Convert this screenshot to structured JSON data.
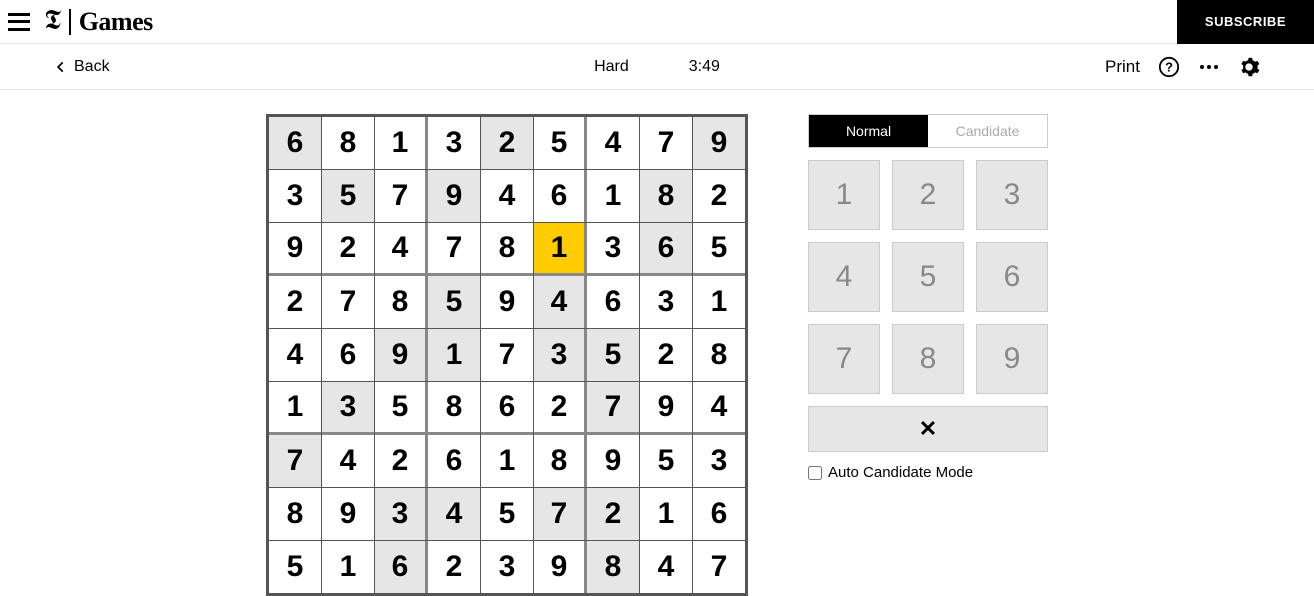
{
  "header": {
    "brand_t": "𝕿",
    "brand_name": "Games",
    "subscribe": "SUBSCRIBE"
  },
  "toolbar": {
    "back": "Back",
    "difficulty": "Hard",
    "timer": "3:49",
    "print": "Print"
  },
  "sudoku": {
    "selected": [
      2,
      5
    ],
    "grid": [
      [
        {
          "v": "6",
          "g": true
        },
        {
          "v": "8",
          "g": false
        },
        {
          "v": "1",
          "g": false
        },
        {
          "v": "3",
          "g": false
        },
        {
          "v": "2",
          "g": true
        },
        {
          "v": "5",
          "g": false
        },
        {
          "v": "4",
          "g": false
        },
        {
          "v": "7",
          "g": false
        },
        {
          "v": "9",
          "g": true
        }
      ],
      [
        {
          "v": "3",
          "g": false
        },
        {
          "v": "5",
          "g": true
        },
        {
          "v": "7",
          "g": false
        },
        {
          "v": "9",
          "g": true
        },
        {
          "v": "4",
          "g": false
        },
        {
          "v": "6",
          "g": false
        },
        {
          "v": "1",
          "g": false
        },
        {
          "v": "8",
          "g": true
        },
        {
          "v": "2",
          "g": false
        }
      ],
      [
        {
          "v": "9",
          "g": false
        },
        {
          "v": "2",
          "g": false
        },
        {
          "v": "4",
          "g": false
        },
        {
          "v": "7",
          "g": false
        },
        {
          "v": "8",
          "g": false
        },
        {
          "v": "1",
          "g": false
        },
        {
          "v": "3",
          "g": false
        },
        {
          "v": "6",
          "g": true
        },
        {
          "v": "5",
          "g": false
        }
      ],
      [
        {
          "v": "2",
          "g": false
        },
        {
          "v": "7",
          "g": false
        },
        {
          "v": "8",
          "g": false
        },
        {
          "v": "5",
          "g": true
        },
        {
          "v": "9",
          "g": false
        },
        {
          "v": "4",
          "g": true
        },
        {
          "v": "6",
          "g": false
        },
        {
          "v": "3",
          "g": false
        },
        {
          "v": "1",
          "g": false
        }
      ],
      [
        {
          "v": "4",
          "g": false
        },
        {
          "v": "6",
          "g": false
        },
        {
          "v": "9",
          "g": true
        },
        {
          "v": "1",
          "g": true
        },
        {
          "v": "7",
          "g": false
        },
        {
          "v": "3",
          "g": true
        },
        {
          "v": "5",
          "g": true
        },
        {
          "v": "2",
          "g": false
        },
        {
          "v": "8",
          "g": false
        }
      ],
      [
        {
          "v": "1",
          "g": false
        },
        {
          "v": "3",
          "g": true
        },
        {
          "v": "5",
          "g": false
        },
        {
          "v": "8",
          "g": false
        },
        {
          "v": "6",
          "g": false
        },
        {
          "v": "2",
          "g": false
        },
        {
          "v": "7",
          "g": true
        },
        {
          "v": "9",
          "g": false
        },
        {
          "v": "4",
          "g": false
        }
      ],
      [
        {
          "v": "7",
          "g": true
        },
        {
          "v": "4",
          "g": false
        },
        {
          "v": "2",
          "g": false
        },
        {
          "v": "6",
          "g": false
        },
        {
          "v": "1",
          "g": false
        },
        {
          "v": "8",
          "g": false
        },
        {
          "v": "9",
          "g": false
        },
        {
          "v": "5",
          "g": false
        },
        {
          "v": "3",
          "g": false
        }
      ],
      [
        {
          "v": "8",
          "g": false
        },
        {
          "v": "9",
          "g": false
        },
        {
          "v": "3",
          "g": true
        },
        {
          "v": "4",
          "g": true
        },
        {
          "v": "5",
          "g": false
        },
        {
          "v": "7",
          "g": true
        },
        {
          "v": "2",
          "g": true
        },
        {
          "v": "1",
          "g": false
        },
        {
          "v": "6",
          "g": false
        }
      ],
      [
        {
          "v": "5",
          "g": false
        },
        {
          "v": "1",
          "g": false
        },
        {
          "v": "6",
          "g": true
        },
        {
          "v": "2",
          "g": false
        },
        {
          "v": "3",
          "g": false
        },
        {
          "v": "9",
          "g": false
        },
        {
          "v": "8",
          "g": true
        },
        {
          "v": "4",
          "g": false
        },
        {
          "v": "7",
          "g": false
        }
      ]
    ]
  },
  "panel": {
    "modes": {
      "normal": "Normal",
      "candidate": "Candidate",
      "active": "normal"
    },
    "numbers": [
      "1",
      "2",
      "3",
      "4",
      "5",
      "6",
      "7",
      "8",
      "9"
    ],
    "erase": "✕",
    "autocand_label": "Auto Candidate Mode",
    "autocand_checked": false
  }
}
